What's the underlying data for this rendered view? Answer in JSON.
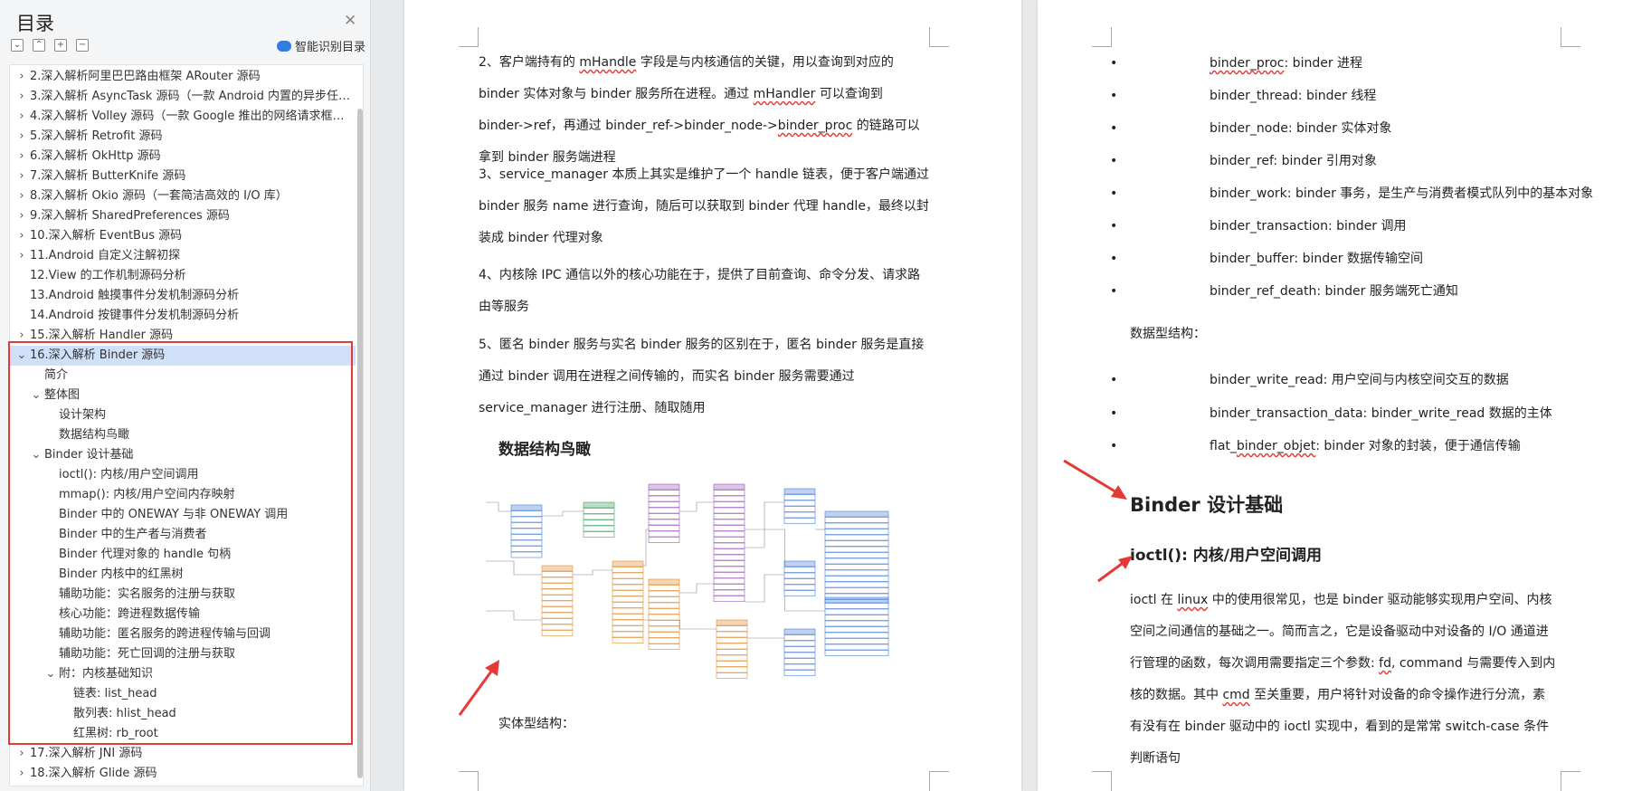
{
  "sidebar": {
    "title": "目录",
    "smart_label": "智能识别目录",
    "items": [
      {
        "label": "2.深入解析阿里巴巴路由框架 ARouter 源码",
        "caret": "›",
        "indent": 0
      },
      {
        "label": "3.深入解析 AsyncTask 源码（一款 Android 内置的异步任务…",
        "caret": "›",
        "indent": 0
      },
      {
        "label": "4.深入解析 Volley 源码（一款 Google 推出的网络请求框架…",
        "caret": "›",
        "indent": 0
      },
      {
        "label": "5.深入解析 Retrofit 源码",
        "caret": "›",
        "indent": 0
      },
      {
        "label": "6.深入解析 OkHttp 源码",
        "caret": "›",
        "indent": 0
      },
      {
        "label": "7.深入解析 ButterKnife 源码",
        "caret": "›",
        "indent": 0
      },
      {
        "label": "8.深入解析 Okio 源码（一套简洁高效的 I/O 库）",
        "caret": "›",
        "indent": 0
      },
      {
        "label": "9.深入解析 SharedPreferences 源码",
        "caret": "›",
        "indent": 0
      },
      {
        "label": "10.深入解析 EventBus 源码",
        "caret": "›",
        "indent": 0
      },
      {
        "label": "11.Android 自定义注解初探",
        "caret": "›",
        "indent": 0
      },
      {
        "label": "12.View 的工作机制源码分析",
        "caret": "",
        "indent": 0
      },
      {
        "label": "13.Android 触摸事件分发机制源码分析",
        "caret": "",
        "indent": 0
      },
      {
        "label": "14.Android 按键事件分发机制源码分析",
        "caret": "",
        "indent": 0
      },
      {
        "label": "15.深入解析 Handler 源码",
        "caret": "›",
        "indent": 0
      },
      {
        "label": "16.深入解析 Binder 源码",
        "caret": "⌄",
        "indent": 0,
        "selected": true
      },
      {
        "label": "简介",
        "caret": "",
        "indent": 1
      },
      {
        "label": "整体图",
        "caret": "⌄",
        "indent": 1
      },
      {
        "label": "设计架构",
        "caret": "",
        "indent": 2
      },
      {
        "label": "数据结构鸟瞰",
        "caret": "",
        "indent": 2
      },
      {
        "label": "Binder 设计基础",
        "caret": "⌄",
        "indent": 1
      },
      {
        "label": "ioctl(): 内核/用户空间调用",
        "caret": "",
        "indent": 2
      },
      {
        "label": "mmap(): 内核/用户空间内存映射",
        "caret": "",
        "indent": 2
      },
      {
        "label": "Binder 中的 ONEWAY 与非 ONEWAY 调用",
        "caret": "",
        "indent": 2
      },
      {
        "label": "Binder 中的生产者与消费者",
        "caret": "",
        "indent": 2
      },
      {
        "label": "Binder 代理对象的 handle 句柄",
        "caret": "",
        "indent": 2
      },
      {
        "label": "Binder 内核中的红黑树",
        "caret": "",
        "indent": 2
      },
      {
        "label": "辅助功能：实名服务的注册与获取",
        "caret": "",
        "indent": 2
      },
      {
        "label": "核心功能：跨进程数据传输",
        "caret": "",
        "indent": 2
      },
      {
        "label": "辅助功能：匿名服务的跨进程传输与回调",
        "caret": "",
        "indent": 2
      },
      {
        "label": "辅助功能：死亡回调的注册与获取",
        "caret": "",
        "indent": 2
      },
      {
        "label": "附：内核基础知识",
        "caret": "⌄",
        "indent": 2
      },
      {
        "label": "链表: list_head",
        "caret": "",
        "indent": 3
      },
      {
        "label": "散列表: hlist_head",
        "caret": "",
        "indent": 3
      },
      {
        "label": "红黑树: rb_root",
        "caret": "",
        "indent": 3
      },
      {
        "label": "17.深入解析 JNI 源码",
        "caret": "›",
        "indent": 0
      },
      {
        "label": "18.深入解析 Glide 源码",
        "caret": "›",
        "indent": 0
      }
    ]
  },
  "page1": {
    "para2": {
      "a": "2、客户端持有的 ",
      "b": "mHandle",
      "c": " 字段是与内核通信的关键，用以查询到对应的 binder 实体对象与 binder 服务所在进程。通过 ",
      "d": "mHandler",
      "e": " 可以查询到 binder->ref，再通过 binder_ref->binder_node->",
      "f": "binder_proc",
      "g": " 的链路可以拿到 binder 服务端进程"
    },
    "para3": "3、service_manager 本质上其实是维护了一个 handle 链表，便于客户端通过 binder 服务 name 进行查询，随后可以获取到 binder 代理 handle，最终以封装成 binder 代理对象",
    "para4": "4、内核除 IPC 通信以外的核心功能在于，提供了目前查询、命令分发、请求路由等服务",
    "para5": "5、匿名 binder 服务与实名 binder 服务的区别在于，匿名 binder 服务是直接通过 binder 调用在进程之间传输的，而实名 binder 服务需要通过 service_manager 进行注册、随取随用",
    "section_title": "数据结构鸟瞰",
    "footer_label": "实体型结构："
  },
  "page2": {
    "entity_bullets": [
      {
        "a": "",
        "u": "binder_proc",
        "b": ": binder 进程"
      },
      {
        "a": "binder_thread: binder 线程",
        "u": "",
        "b": ""
      },
      {
        "a": "binder_node: binder 实体对象",
        "u": "",
        "b": ""
      },
      {
        "a": "binder_ref: binder 引用对象",
        "u": "",
        "b": ""
      },
      {
        "a": "binder_work: binder 事务，是生产与消费者模式队列中的基本对象",
        "u": "",
        "b": ""
      },
      {
        "a": "binder_transaction: binder 调用",
        "u": "",
        "b": ""
      },
      {
        "a": "binder_buffer: binder 数据传输空间",
        "u": "",
        "b": ""
      },
      {
        "a": "binder_ref_death: binder 服务端死亡通知",
        "u": "",
        "b": ""
      }
    ],
    "data_label": "数据型结构：",
    "data_bullets": [
      {
        "a": "binder_write_read: 用户空间与内核空间交互的数据",
        "u": "",
        "b": ""
      },
      {
        "a": "binder_transaction_data: binder_write_read 数据的主体",
        "u": "",
        "b": ""
      },
      {
        "a": "flat_",
        "u": "binder_objet",
        "b": ": binder 对象的封装，便于通信传输"
      }
    ],
    "h2": "Binder 设计基础",
    "h3": "ioctl(): 内核/用户空间调用",
    "body": {
      "a": "ioctl 在 ",
      "b": "linux",
      "c": " 中的使用很常见，也是 binder 驱动能够实现用户空间、内核空间之间通信的基础之一。简而言之，它是设备驱动中对设备的 I/O 通道进行管理的函数，每次调用需要指定三个参数: ",
      "d": "fd",
      "e": ", command 与需要传入到内核的数据。其中 ",
      "f": "cmd",
      "g": " 至关重要，用户将针对设备的命令操作进行分流，素有没有在 binder 驱动中的 ioctl 实现中，看到的是常常 switch-case 条件判断语句"
    }
  },
  "colors": {
    "highlight": "#e53935",
    "selected_row": "#cfe0f8",
    "accent": "#2f7de1"
  }
}
